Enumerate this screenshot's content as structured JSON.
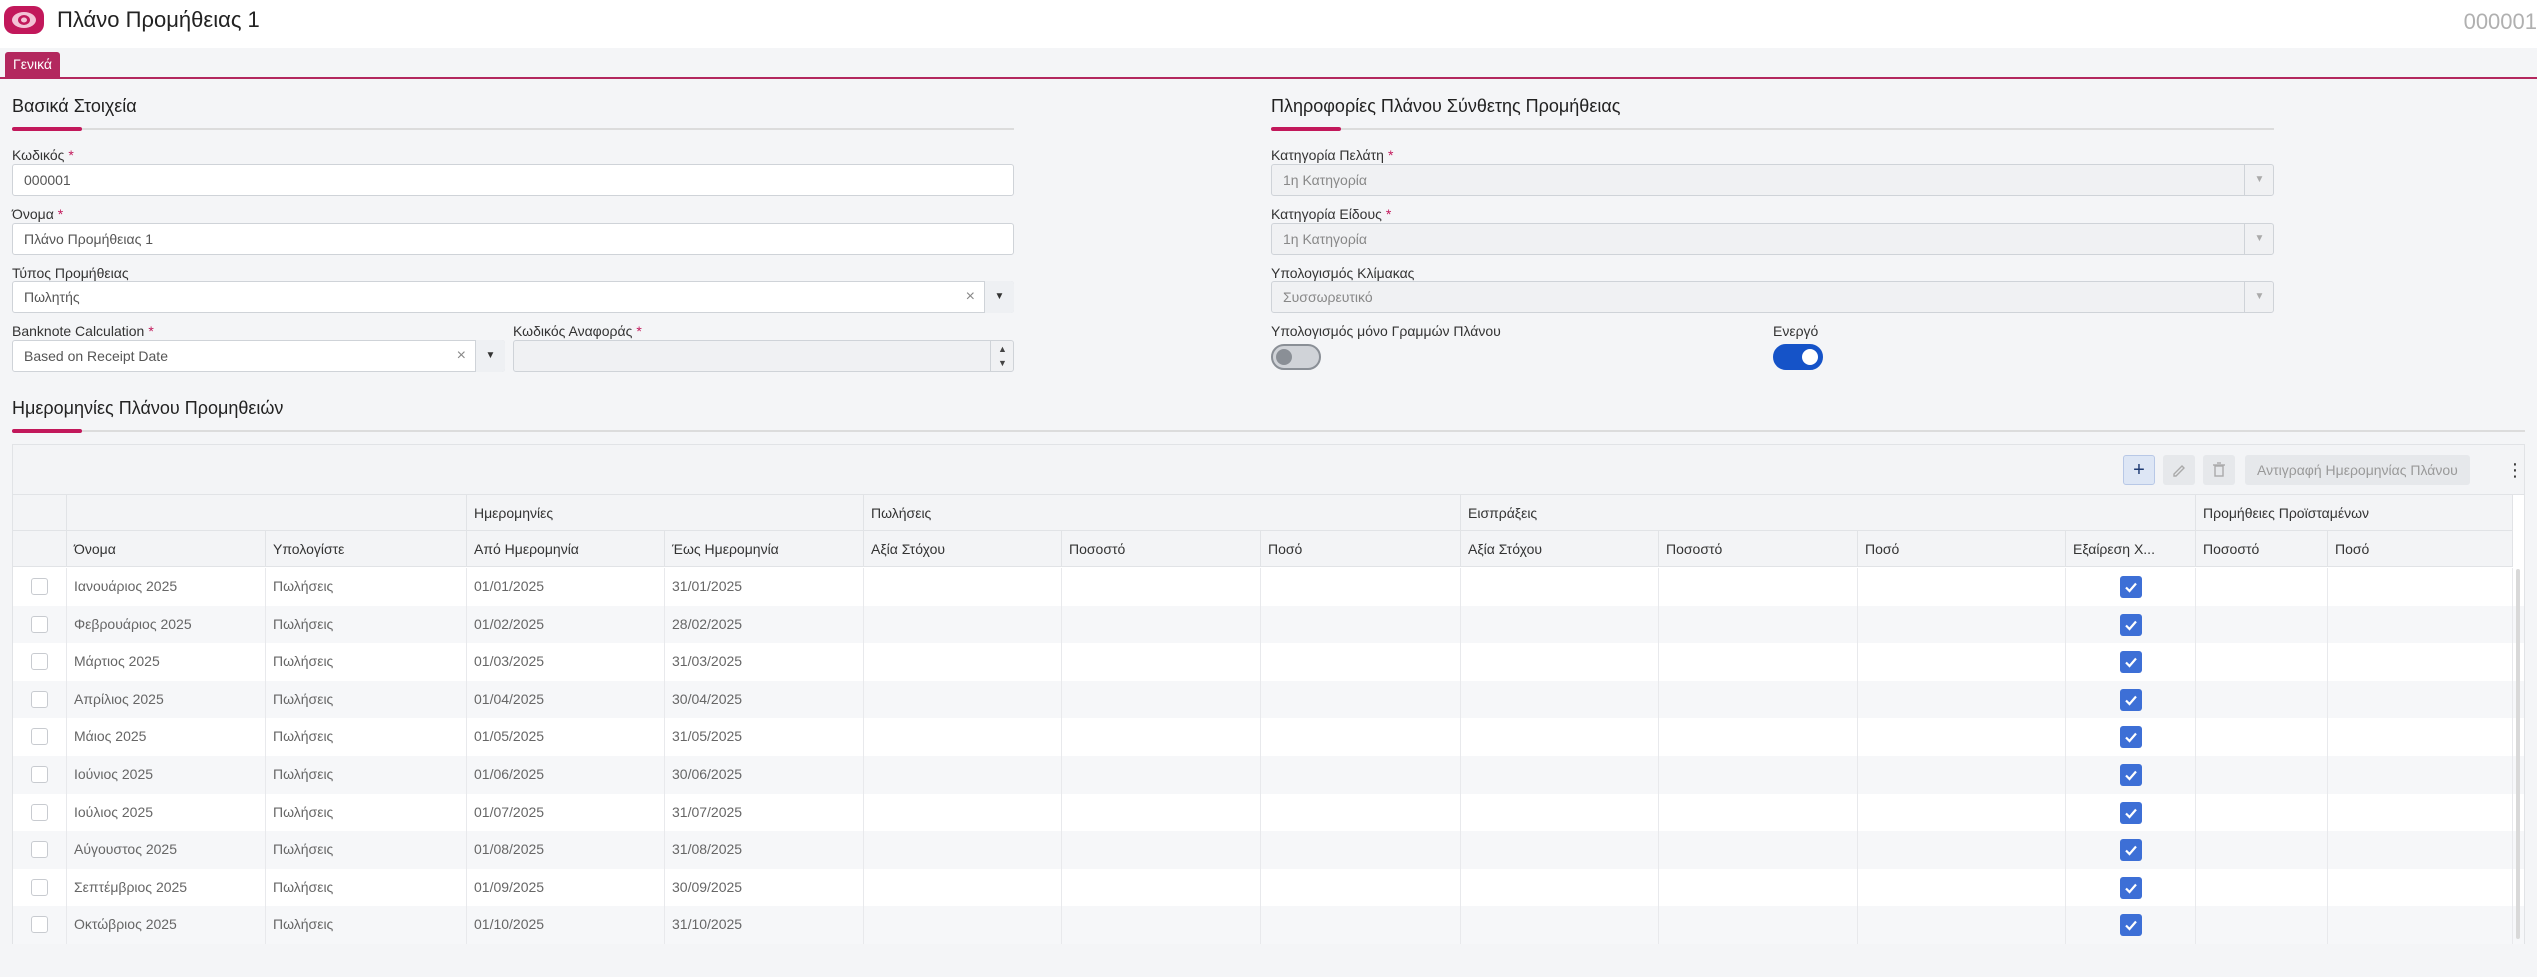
{
  "header": {
    "icon": "banknotes-icon",
    "title": "Πλάνο Προμήθειας 1",
    "record_id": "000001"
  },
  "tabs": [
    {
      "label": "Γενικά",
      "active": true
    }
  ],
  "colors": {
    "accent": "#c2185b",
    "toggle_on": "#1553c8",
    "checkbox_on": "#3d6fd6"
  },
  "basic": {
    "title": "Βασικά Στοιχεία",
    "code_label": "Κωδικός",
    "code_value": "000001",
    "name_label": "Όνομα",
    "name_value": "Πλάνο Προμήθειας 1",
    "type_label": "Τύπος Προμήθειας",
    "type_value": "Πωλητής",
    "banknote_label": "Banknote Calculation",
    "banknote_value": "Based on Receipt Date",
    "refcode_label": "Κωδικός Αναφοράς",
    "refcode_value": "",
    "required_mark": "*"
  },
  "composite": {
    "title": "Πληροφορίες Πλάνου Σύνθετης Προμήθειας",
    "customer_cat_label": "Κατηγορία Πελάτη",
    "customer_cat_value": "1η Κατηγορία",
    "item_cat_label": "Κατηγορία Είδους",
    "item_cat_value": "1η Κατηγορία",
    "scale_label": "Υπολογισμός Κλίμακας",
    "scale_value": "Συσσωρευτικό",
    "lines_only_label": "Υπολογισμός μόνο Γραμμών Πλάνου",
    "lines_only_on": false,
    "active_label": "Ενεργό",
    "active_on": true
  },
  "dates_section": {
    "title": "Ημερομηνίες Πλάνου Προμηθειών",
    "toolbar": {
      "add": "+",
      "edit_icon": "pencil-icon",
      "delete_icon": "trash-icon",
      "copy_label": "Αντιγραφή Ημερομηνίας Πλάνου",
      "more": "⋮"
    },
    "groups": [
      "Ημερομηνίες",
      "Πωλήσεις",
      "Εισπράξεις",
      "Προμήθειες Προϊσταμένων"
    ],
    "columns": [
      "Όνομα",
      "Υπολογίστε",
      "Από Ημερομηνία",
      "Έως Ημερομηνία",
      "Αξία Στόχου",
      "Ποσοστό",
      "Ποσό",
      "Αξία Στόχου",
      "Ποσοστό",
      "Ποσό",
      "Εξαίρεση Χ...",
      "Ποσοστό",
      "Ποσό"
    ],
    "rows": [
      {
        "name": "Ιανουάριος 2025",
        "calc": "Πωλήσεις",
        "from": "01/01/2025",
        "to": "31/01/2025",
        "exclude": true
      },
      {
        "name": "Φεβρουάριος 2025",
        "calc": "Πωλήσεις",
        "from": "01/02/2025",
        "to": "28/02/2025",
        "exclude": true
      },
      {
        "name": "Μάρτιος 2025",
        "calc": "Πωλήσεις",
        "from": "01/03/2025",
        "to": "31/03/2025",
        "exclude": true
      },
      {
        "name": "Απρίλιος 2025",
        "calc": "Πωλήσεις",
        "from": "01/04/2025",
        "to": "30/04/2025",
        "exclude": true
      },
      {
        "name": "Μάιος 2025",
        "calc": "Πωλήσεις",
        "from": "01/05/2025",
        "to": "31/05/2025",
        "exclude": true
      },
      {
        "name": "Ιούνιος 2025",
        "calc": "Πωλήσεις",
        "from": "01/06/2025",
        "to": "30/06/2025",
        "exclude": true
      },
      {
        "name": "Ιούλιος 2025",
        "calc": "Πωλήσεις",
        "from": "01/07/2025",
        "to": "31/07/2025",
        "exclude": true
      },
      {
        "name": "Αύγουστος 2025",
        "calc": "Πωλήσεις",
        "from": "01/08/2025",
        "to": "31/08/2025",
        "exclude": true
      },
      {
        "name": "Σεπτέμβριος 2025",
        "calc": "Πωλήσεις",
        "from": "01/09/2025",
        "to": "30/09/2025",
        "exclude": true
      },
      {
        "name": "Οκτώβριος 2025",
        "calc": "Πωλήσεις",
        "from": "01/10/2025",
        "to": "31/10/2025",
        "exclude": true
      }
    ]
  }
}
